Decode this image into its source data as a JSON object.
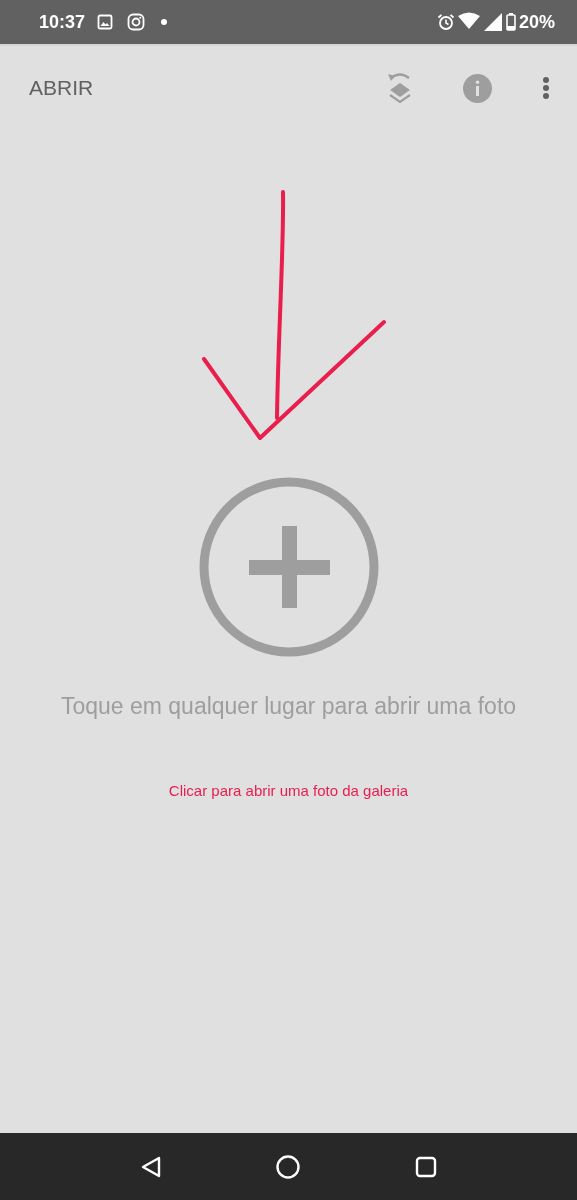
{
  "status_bar": {
    "time": "10:37",
    "battery": "20%"
  },
  "toolbar": {
    "title": "ABRIR"
  },
  "main": {
    "prompt": "Toque em qualquer lugar para abrir uma foto",
    "gallery_link": "Clicar para abrir uma foto da galeria"
  }
}
